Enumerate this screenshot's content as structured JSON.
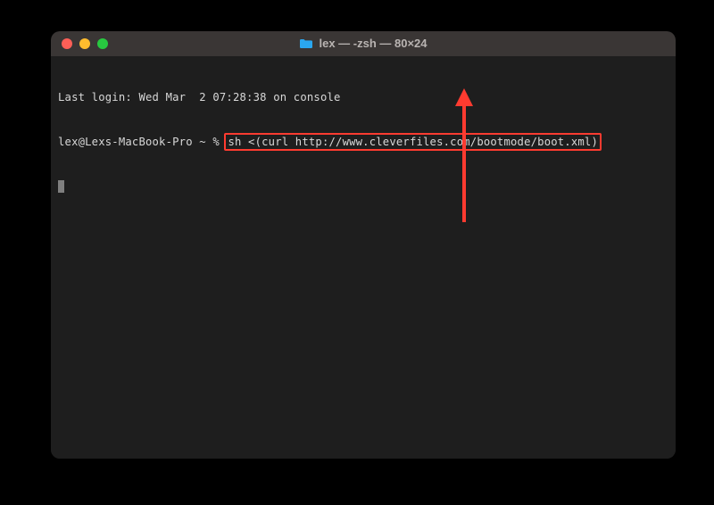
{
  "window": {
    "title": "lex — -zsh — 80×24"
  },
  "terminal": {
    "last_login": "Last login: Wed Mar  2 07:28:38 on console",
    "prompt": "lex@Lexs-MacBook-Pro ~ % ",
    "command": "sh <(curl http://www.cleverfiles.com/bootmode/boot.xml)"
  },
  "annotation": {
    "highlight_color": "#ff3b30"
  }
}
